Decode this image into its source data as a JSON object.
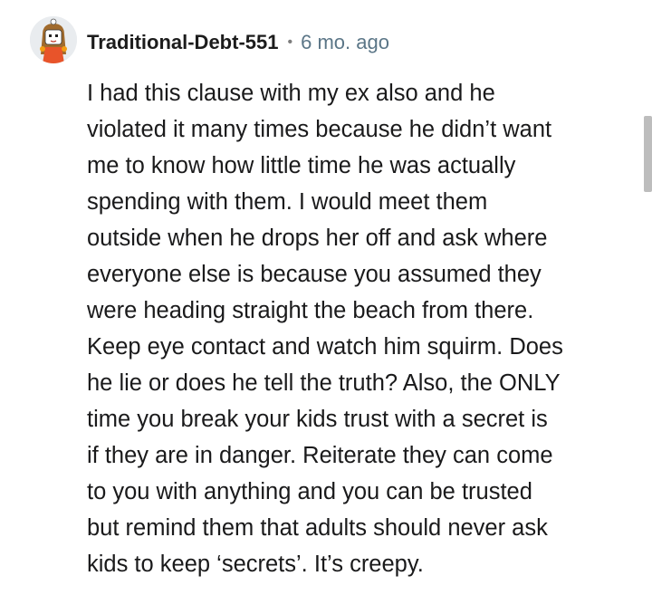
{
  "comment": {
    "author": "Traditional-Debt-551",
    "separator": "•",
    "timestamp": "6 mo. ago",
    "avatar_icon": "user-avatar-icon",
    "body_lines": [
      "I had this clause with my ex also and he",
      "violated it many times because he didn’t want",
      "me to know how little time he was actually",
      "spending with them. I would meet them",
      "outside when he drops her off and ask where",
      "everyone else is because you assumed they",
      "were heading straight the beach from there.",
      "Keep eye contact and watch him squirm. Does",
      "he lie or does he tell the truth? Also, the ONLY",
      "time you break your kids trust with a secret is",
      "if they are in danger. Reiterate they can come",
      "to you with anything and you can be trusted",
      "but remind them that adults should never ask",
      "kids to keep ‘secrets’. It’s creepy."
    ]
  },
  "colors": {
    "username": "#1c1c1c",
    "timestamp": "#5b7687",
    "body": "#1a1a1b",
    "scrollbar": "#bdbdbd",
    "avatar_bg": "#e9ecef"
  }
}
